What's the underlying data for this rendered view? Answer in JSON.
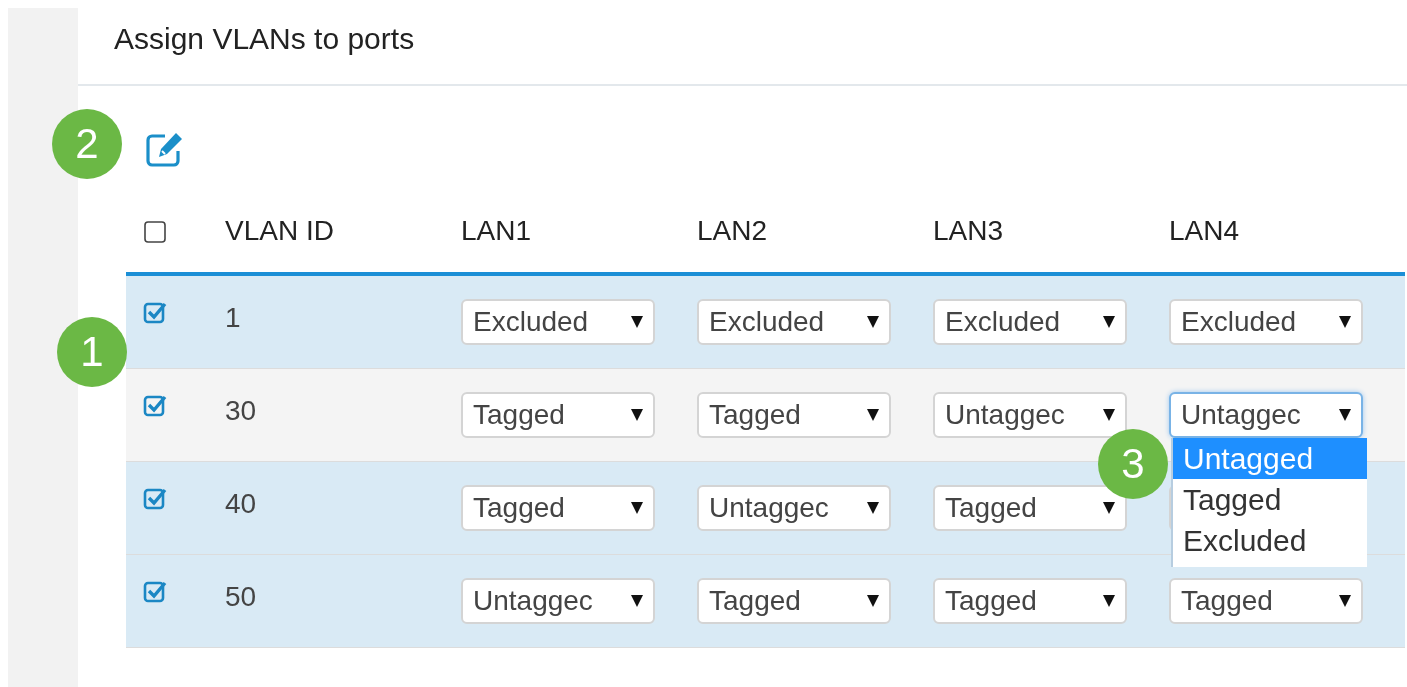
{
  "title": "Assign VLANs to ports",
  "toolbar": {
    "callout": "2"
  },
  "table": {
    "select_all": {
      "checked": false
    },
    "callout": "1",
    "columns": [
      "VLAN ID",
      "LAN1",
      "LAN2",
      "LAN3",
      "LAN4"
    ],
    "rows": [
      {
        "checked": true,
        "selected": true,
        "cells": [
          {
            "kind": "text",
            "value": "1"
          },
          {
            "kind": "select",
            "value": "Excluded"
          },
          {
            "kind": "select",
            "value": "Excluded"
          },
          {
            "kind": "select",
            "value": "Excluded"
          },
          {
            "kind": "select",
            "value": "Excluded"
          }
        ]
      },
      {
        "checked": true,
        "selected": false,
        "cells": [
          {
            "kind": "text",
            "value": "30"
          },
          {
            "kind": "select",
            "value": "Tagged"
          },
          {
            "kind": "select",
            "value": "Tagged"
          },
          {
            "kind": "select",
            "value": "Untaggec"
          },
          {
            "kind": "select",
            "value": "Untaggec",
            "open": true,
            "callout": "3",
            "options": [
              {
                "label": "Untagged",
                "selected": true
              },
              {
                "label": "Tagged",
                "selected": false
              },
              {
                "label": "Excluded",
                "selected": false
              }
            ]
          }
        ]
      },
      {
        "checked": true,
        "selected": true,
        "cells": [
          {
            "kind": "text",
            "value": "40"
          },
          {
            "kind": "select",
            "value": "Tagged"
          },
          {
            "kind": "select",
            "value": "Untaggec"
          },
          {
            "kind": "select",
            "value": "Tagged"
          }
        ]
      },
      {
        "checked": true,
        "selected": true,
        "cells": [
          {
            "kind": "text",
            "value": "50"
          },
          {
            "kind": "select",
            "value": "Untaggec"
          },
          {
            "kind": "select",
            "value": "Tagged"
          },
          {
            "kind": "select",
            "value": "Tagged"
          },
          {
            "kind": "select",
            "value": "Tagged"
          }
        ]
      }
    ]
  }
}
